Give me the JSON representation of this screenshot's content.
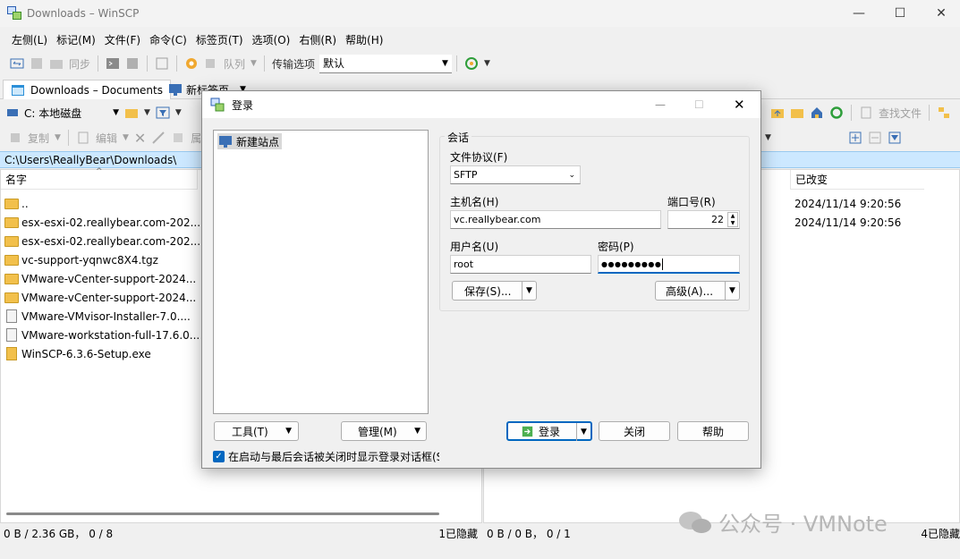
{
  "window": {
    "title": "Downloads – WinSCP"
  },
  "menu": [
    "左侧(L)",
    "标记(M)",
    "文件(F)",
    "命令(C)",
    "标签页(T)",
    "选项(O)",
    "右侧(R)",
    "帮助(H)"
  ],
  "toolbar": {
    "sync": "同步",
    "queue": "队列",
    "transfer_label": "传输选项",
    "transfer_value": "默认"
  },
  "tabs": {
    "active": "Downloads – Documents",
    "new": "新标签页"
  },
  "local": {
    "drive": "C: 本地磁盘",
    "copy": "复制",
    "edit": "编辑",
    "attr": "属",
    "path": "C:\\Users\\ReallyBear\\Downloads\\",
    "col_name": "名字",
    "files": [
      "..",
      "esx-esxi-02.reallybear.com-202...",
      "esx-esxi-02.reallybear.com-202...",
      "vc-support-yqnwc8X4.tgz",
      "VMware-vCenter-support-2024...",
      "VMware-vCenter-support-2024...",
      "VMware-VMvisor-Installer-7.0....",
      "VMware-workstation-full-17.6.0...",
      "WinSCP-6.3.6-Setup.exe"
    ],
    "status_left": "0 B / 2.36 GB， 0 / 8",
    "status_hidden": "1已隐藏"
  },
  "remote": {
    "find_files": "查找文件",
    "col_changed": "已改变",
    "dates": [
      "2024/11/14 9:20:56",
      "2024/11/14 9:20:56"
    ],
    "status_left": "0 B / 0 B， 0 / 1",
    "status_hidden": "4已隐藏"
  },
  "dialog": {
    "title": "登录",
    "site": "新建站点",
    "session": "会话",
    "protocol_label": "文件协议(F)",
    "protocol": "SFTP",
    "host_label": "主机名(H)",
    "host": "vc.reallybear.com",
    "port_label": "端口号(R)",
    "port": "22",
    "user_label": "用户名(U)",
    "user": "root",
    "pass_label": "密码(P)",
    "pass": "●●●●●●●●●",
    "save": "保存(S)...",
    "advanced": "高级(A)...",
    "tools": "工具(T)",
    "manage": "管理(M)",
    "login": "登录",
    "close": "关闭",
    "help": "帮助",
    "checkbox": "在启动与最后会话被关闭时显示登录对话框(S"
  },
  "watermark": "公众号 · VMNote"
}
